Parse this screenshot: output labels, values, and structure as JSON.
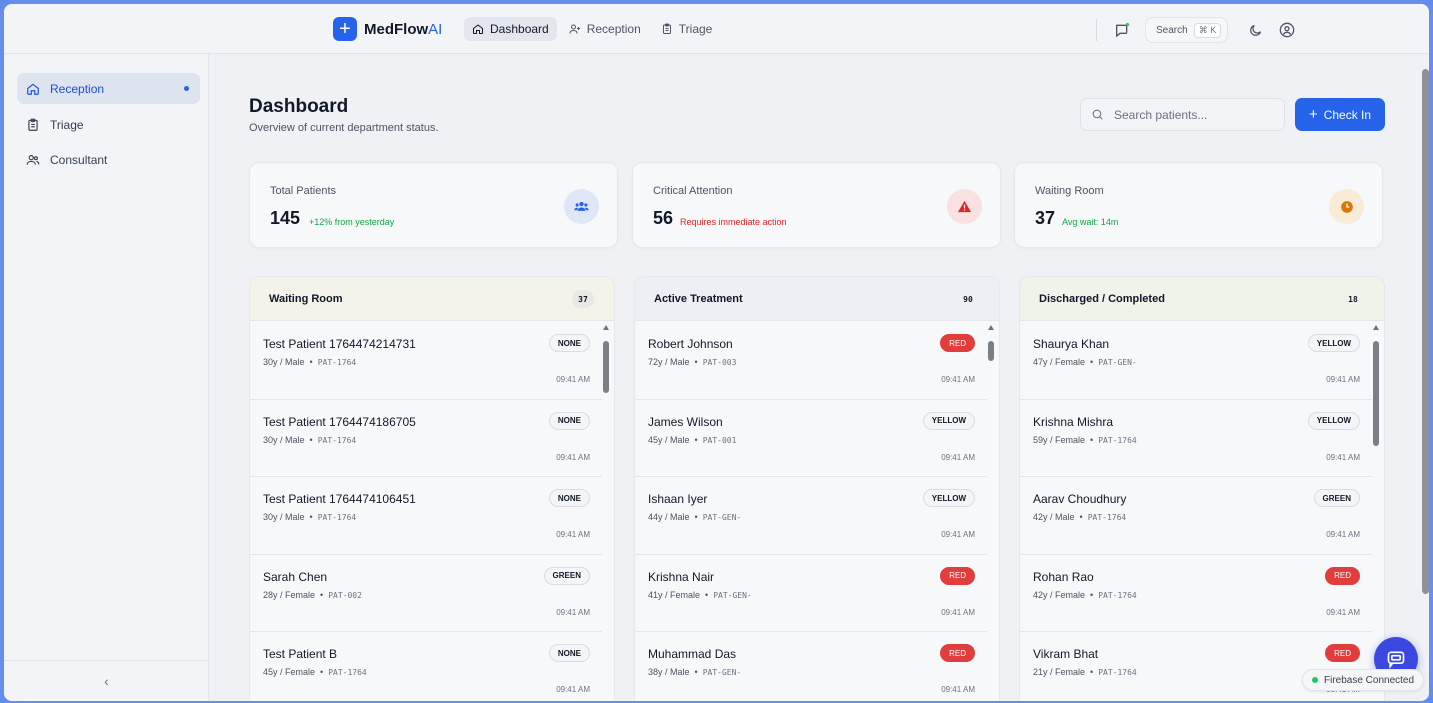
{
  "app": {
    "name": "MedFlow",
    "name_suffix": "AI"
  },
  "topnav": [
    {
      "label": "Dashboard",
      "icon": "home-icon",
      "active": true
    },
    {
      "label": "Reception",
      "icon": "user-plus-icon",
      "active": false
    },
    {
      "label": "Triage",
      "icon": "clipboard-icon",
      "active": false
    }
  ],
  "topbar": {
    "search_label": "Search",
    "shortcut": "⌘ K"
  },
  "sidebar": {
    "items": [
      {
        "label": "Reception",
        "icon": "home-icon",
        "active": true
      },
      {
        "label": "Triage",
        "icon": "clipboard-icon",
        "active": false
      },
      {
        "label": "Consultant",
        "icon": "users-icon",
        "active": false
      }
    ],
    "collapse_label": "‹"
  },
  "header": {
    "title": "Dashboard",
    "subtitle": "Overview of current department status.",
    "search_placeholder": "Search patients...",
    "checkin_label": "Check In"
  },
  "stats": [
    {
      "label": "Total Patients",
      "value": "145",
      "note": "+12% from yesterday",
      "note_color": "#16a34a",
      "icon": "users-icon",
      "icon_bg": "#dfe7f7",
      "icon_color": "#2563eb"
    },
    {
      "label": "Critical Attention",
      "value": "56",
      "note": "Requires immediate action",
      "note_color": "#dc2626",
      "icon": "alert-triangle-icon",
      "icon_bg": "#f9e1e1",
      "icon_color": "#dc2626"
    },
    {
      "label": "Waiting Room",
      "value": "37",
      "note": "Avg wait: 14m",
      "note_color": "#16a34a",
      "icon": "clock-icon",
      "icon_bg": "#f8ecd8",
      "icon_color": "#d97706"
    }
  ],
  "columns": [
    {
      "title": "Waiting Room",
      "count": "37",
      "head_bg": "#f3f3e9",
      "count_bg": "#e8e9e4",
      "patients": [
        {
          "name": "Test Patient 1764474214731",
          "meta": "30y / Male",
          "id": "PAT-1764",
          "time": "09:41 AM",
          "triage": "NONE"
        },
        {
          "name": "Test Patient 1764474186705",
          "meta": "30y / Male",
          "id": "PAT-1764",
          "time": "09:41 AM",
          "triage": "NONE"
        },
        {
          "name": "Test Patient 1764474106451",
          "meta": "30y / Male",
          "id": "PAT-1764",
          "time": "09:41 AM",
          "triage": "NONE"
        },
        {
          "name": "Sarah Chen",
          "meta": "28y / Female",
          "id": "PAT-002",
          "time": "09:41 AM",
          "triage": "GREEN"
        },
        {
          "name": "Test Patient B",
          "meta": "45y / Female",
          "id": "PAT-1764",
          "time": "09:41 AM",
          "triage": "NONE"
        }
      ]
    },
    {
      "title": "Active Treatment",
      "count": "90",
      "head_bg": "#eeeff5",
      "count_bg": "transparent",
      "patients": [
        {
          "name": "Robert Johnson",
          "meta": "72y / Male",
          "id": "PAT-003",
          "time": "09:41 AM",
          "triage": "RED"
        },
        {
          "name": "James Wilson",
          "meta": "45y / Male",
          "id": "PAT-001",
          "time": "09:41 AM",
          "triage": "YELLOW"
        },
        {
          "name": "Ishaan Iyer",
          "meta": "44y / Male",
          "id": "PAT-GEN-",
          "time": "09:41 AM",
          "triage": "YELLOW"
        },
        {
          "name": "Krishna Nair",
          "meta": "41y / Female",
          "id": "PAT-GEN-",
          "time": "09:41 AM",
          "triage": "RED"
        },
        {
          "name": "Muhammad Das",
          "meta": "38y / Male",
          "id": "PAT-GEN-",
          "time": "09:41 AM",
          "triage": "RED"
        }
      ]
    },
    {
      "title": "Discharged / Completed",
      "count": "18",
      "head_bg": "#eff3ea",
      "count_bg": "transparent",
      "patients": [
        {
          "name": "Shaurya Khan",
          "meta": "47y / Female",
          "id": "PAT-GEN-",
          "time": "09:41 AM",
          "triage": "YELLOW"
        },
        {
          "name": "Krishna Mishra",
          "meta": "59y / Female",
          "id": "PAT-1764",
          "time": "09:41 AM",
          "triage": "YELLOW"
        },
        {
          "name": "Aarav Choudhury",
          "meta": "42y / Male",
          "id": "PAT-1764",
          "time": "09:41 AM",
          "triage": "GREEN"
        },
        {
          "name": "Rohan Rao",
          "meta": "42y / Female",
          "id": "PAT-1764",
          "time": "09:41 AM",
          "triage": "RED"
        },
        {
          "name": "Vikram Bhat",
          "meta": "21y / Female",
          "id": "PAT-1764",
          "time": "09:41 AM",
          "triage": "RED"
        }
      ]
    }
  ],
  "status": {
    "firebase": "Firebase Connected"
  },
  "colors": {
    "accent": "#2563eb",
    "red_badge": "#e13d3d",
    "fab": "#3b48e0",
    "connected": "#22c55e"
  }
}
